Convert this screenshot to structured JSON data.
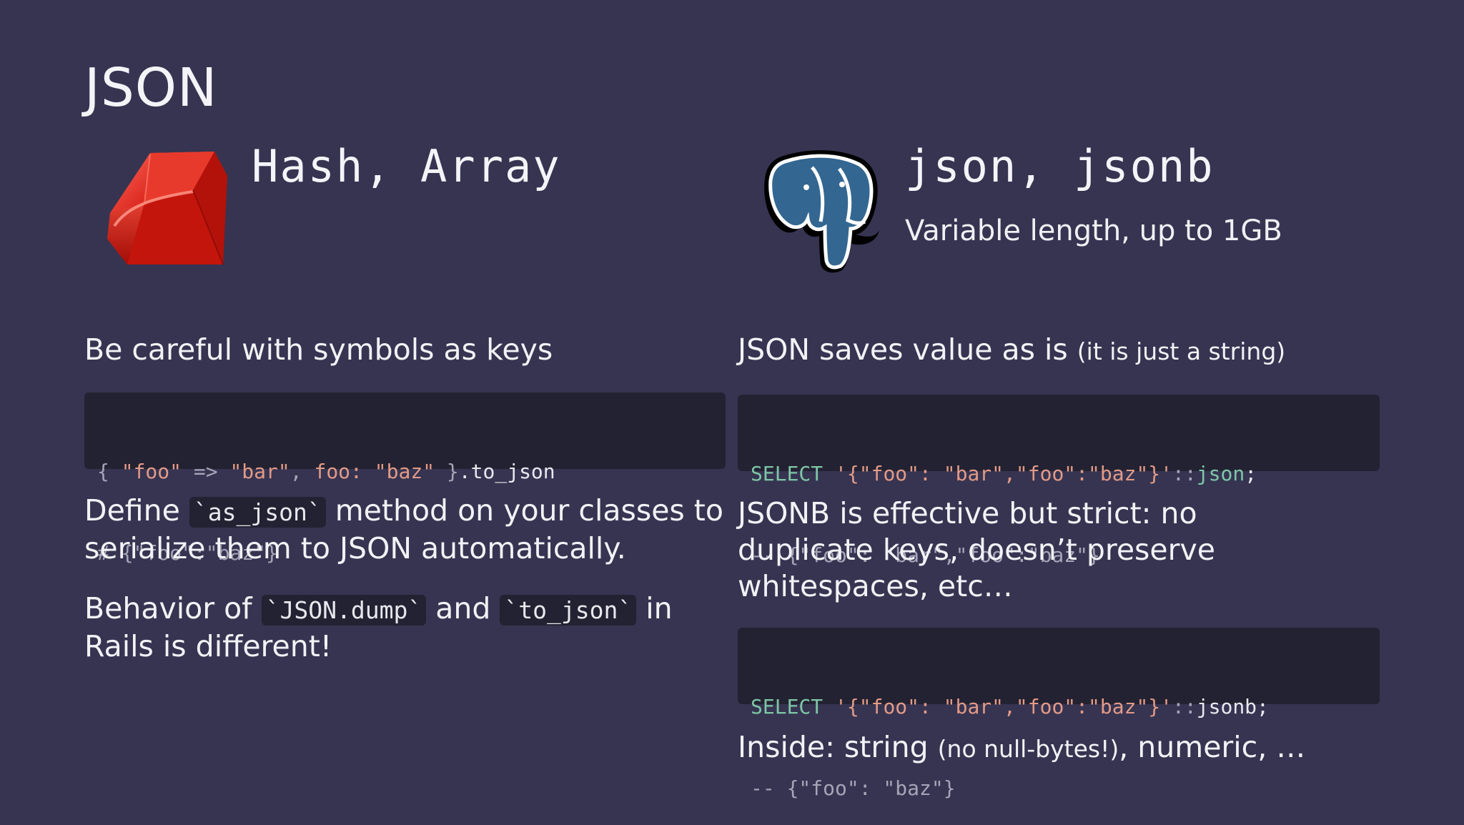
{
  "slide": {
    "title": "JSON"
  },
  "left": {
    "logo": "ruby-gem-icon",
    "heading": "Hash, Array",
    "note": "Be careful with symbols as keys",
    "code": {
      "line1": {
        "open": "{ ",
        "str1": "\"foo\"",
        "arrow": " => ",
        "str2": "\"bar\"",
        "comma": ", ",
        "sym": "foo:",
        "sp": " ",
        "str3": "\"baz\"",
        "close": " }",
        "method": ".to_json"
      },
      "line2": "# {\"foo\":\"baz\"}"
    },
    "para1": {
      "pre": "Define ",
      "code": "`as_json`",
      "post": " method on your classes to serialize them to JSON automatically."
    },
    "para2": {
      "pre": "Behavior of ",
      "code1": "`JSON.dump`",
      "mid": " and ",
      "code2": "`to_json`",
      "post": " in Rails is different!"
    }
  },
  "right": {
    "logo": "postgresql-elephant-icon",
    "heading": "json, jsonb",
    "subheading": "Variable length, up to 1GB",
    "note": {
      "main": "JSON saves value as is ",
      "aside": "(it is just a string)"
    },
    "code1": {
      "kw": "SELECT",
      "sp": " ",
      "str": "'{\"foo\": \"bar\",\"foo\":\"baz\"}'",
      "cast": "::",
      "type": "json",
      "end": ";",
      "comment": "-- {\"foo\": \"bar\",\"foo\":\"baz\"}"
    },
    "para": "JSONB is effective but strict: no duplicate keys, doesn’t preserve whitespaces, etc…",
    "code2": {
      "kw": "SELECT",
      "sp": " ",
      "str": "'{\"foo\": \"bar\",\"foo\":\"baz\"}'",
      "cast": "::",
      "type": "jsonb",
      "end": ";",
      "comment": "-- {\"foo\": \"baz\"}"
    },
    "footer": {
      "pre": "Inside: string ",
      "aside": "(no null-bytes!)",
      "post": ", numeric, …"
    }
  },
  "colors": {
    "background": "#363451",
    "code_background": "#232232",
    "string": "#e39a86",
    "keyword": "#7ec6a6",
    "comment": "#a5a5b8"
  }
}
